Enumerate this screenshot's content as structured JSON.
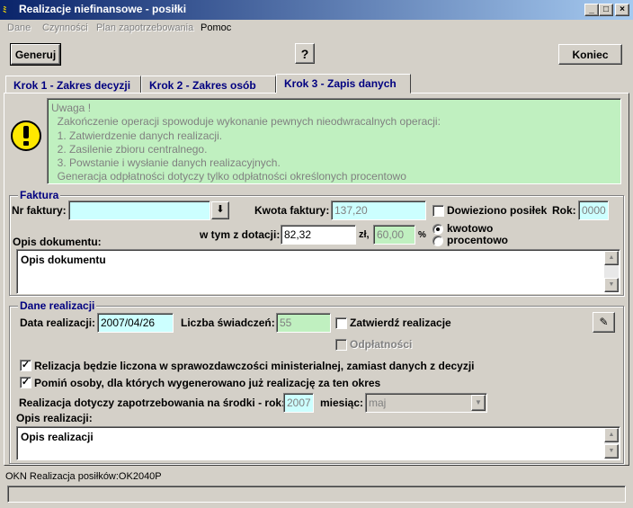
{
  "window": {
    "title": "Realizacje niefinansowe - posiłki",
    "icon_text": "ﾐ"
  },
  "title_buttons": {
    "minimize": "_",
    "maximize": "□",
    "close": "×"
  },
  "menu": [
    {
      "label": "Dane",
      "enabled": false
    },
    {
      "label": "Czynności",
      "enabled": false
    },
    {
      "label": "Plan zapotrzebowania",
      "enabled": false
    },
    {
      "label": "Pomoc",
      "enabled": true
    }
  ],
  "toolbar": {
    "generate_label": "Generuj",
    "help_label": "?",
    "exit_label": "Koniec"
  },
  "tabs": [
    {
      "label": "Krok 1 - Zakres decyzji",
      "active": false
    },
    {
      "label": "Krok 2 - Zakres osób",
      "active": false
    },
    {
      "label": "Krok 3 - Zapis danych",
      "active": true
    }
  ],
  "warning": {
    "icon": "exclamation-icon",
    "lines": [
      "Uwaga !",
      "  Zakończenie operacji spowoduje wykonanie pewnych nieodwracalnych operacji:",
      "  1. Zatwierdzenie danych realizacji.",
      "  2. Zasilenie zbioru centralnego.",
      "  3. Powstanie i wysłanie danych realizacyjnych.",
      "  Generacja odpłatności dotyczy tylko odpłatności określonych procentowo"
    ]
  },
  "faktura": {
    "legend": "Faktura",
    "nr_label": "Nr faktury:",
    "nr_value": "",
    "kwota_label": "Kwota faktury:",
    "kwota_value": "137,20",
    "dowieziono_label": "Dowieziono posiłek",
    "dowieziono_checked": false,
    "rok_label": "Rok:",
    "rok_value": "0000",
    "dotacja_label": "w tym z dotacji:",
    "dotacja_value": "82,32",
    "zl_label": "zł,",
    "procent_value": "60,00",
    "procent_label": "%",
    "radio_kwotowo": "kwotowo",
    "radio_procentowo": "procentowo",
    "selected_mode": "kwotowo",
    "opis_label": "Opis dokumentu:",
    "opis_value": "Opis dokumentu"
  },
  "realizacja": {
    "legend": "Dane realizacji",
    "data_label": "Data realizacji:",
    "data_value": "2007/04/26",
    "liczba_label": "Liczba świadczeń:",
    "liczba_value": "55",
    "zatwierdz_label": "Zatwierdź realizacje",
    "zatwierdz_checked": false,
    "odplatnosci_label": "Odpłatności",
    "odplatnosci_checked": false,
    "ministerial_label": "Relizacja będzie liczona w sprawozdawczości ministerialnej, zamiast danych z decyzji",
    "ministerial_checked": true,
    "pomin_label": "Pomiń osoby, dla których wygenerowano już realizację za ten okres",
    "pomin_checked": true,
    "dotyczy_label": "Realizacja dotyczy zapotrzebowania na środki - rok:",
    "rok_value": "2007",
    "miesiac_label": "miesiąc:",
    "miesiac_value": "maj",
    "opis_label": "Opis realizacji:",
    "opis_value": "Opis realizacji"
  },
  "status": {
    "text": "OKN Realizacja posiłków:OK2040P",
    "panel_text": ""
  }
}
